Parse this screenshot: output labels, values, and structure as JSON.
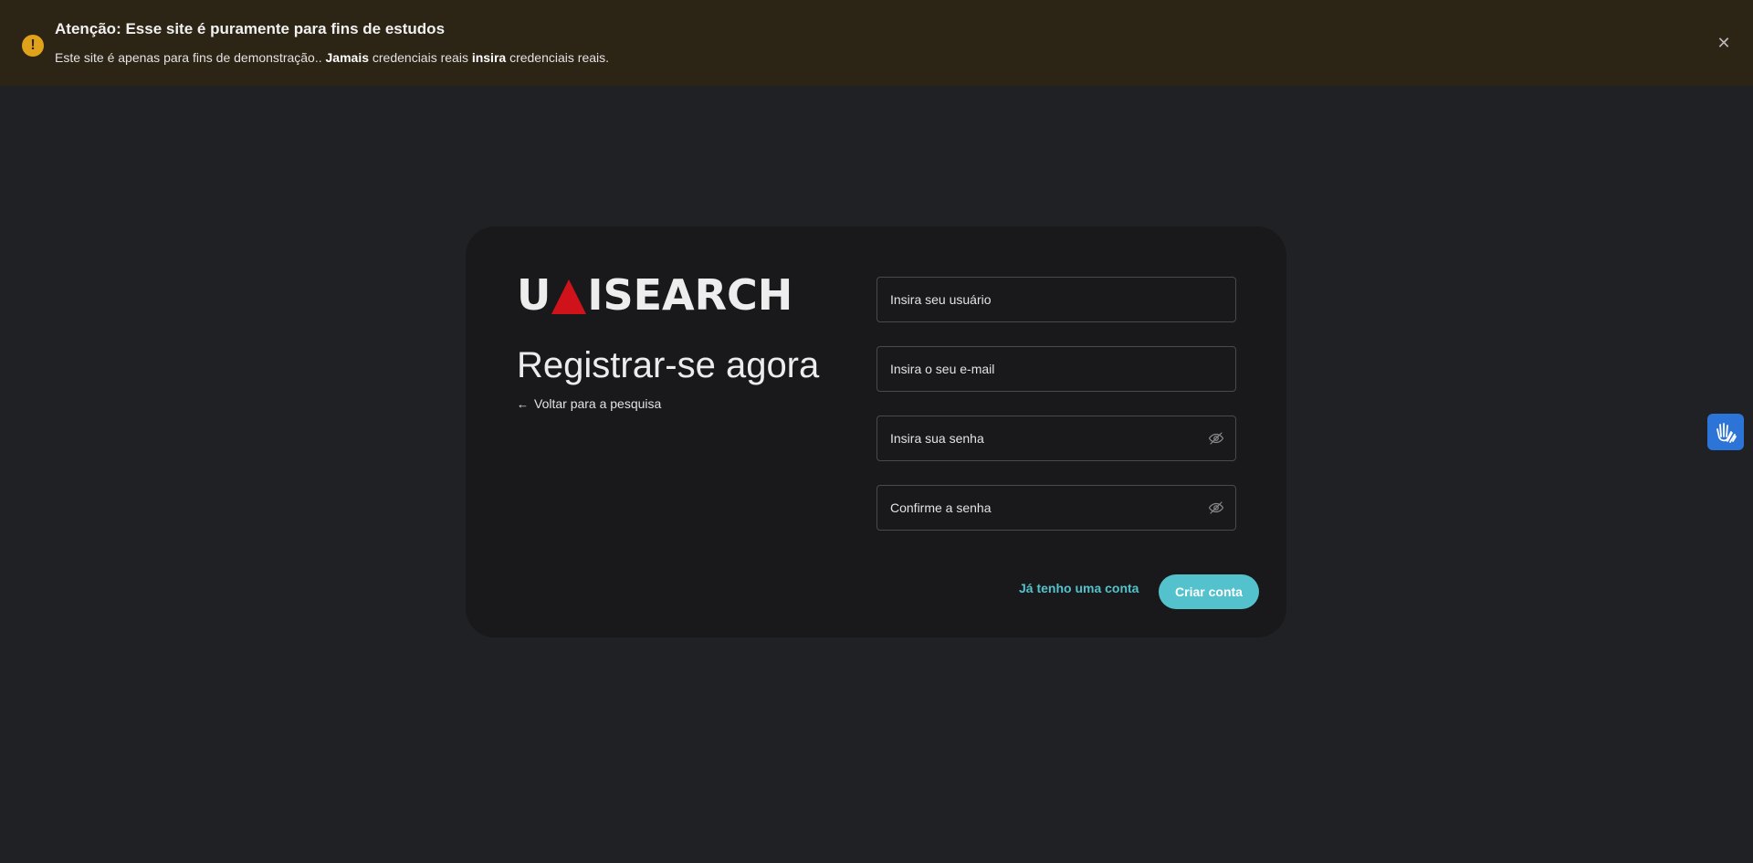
{
  "banner": {
    "icon": "exclamation-icon",
    "title": "Atenção: Esse site é puramente para fins de estudos",
    "msg_part1": "Este site é apenas para fins de demonstração.. ",
    "msg_bold1": "Jamais",
    "msg_part2": " credenciais reais ",
    "msg_bold2": "insira",
    "msg_part3": " credenciais reais.",
    "close_icon": "close-icon",
    "accent_color": "#e0a21b"
  },
  "logo": {
    "text_left": "U",
    "text_right": "ISEARCH",
    "mark_color": "#d0121b"
  },
  "page": {
    "heading": "Registrar-se agora",
    "back_arrow": "←",
    "back_label": "Voltar para a pesquisa"
  },
  "form": {
    "username_placeholder": "Insira seu usuário",
    "email_placeholder": "Insira o seu e-mail",
    "password_placeholder": "Insira sua senha",
    "confirm_placeholder": "Confirme a senha",
    "password_toggle_icon": "eye-off-icon"
  },
  "actions": {
    "login_label": "Já tenho uma conta",
    "create_label": "Criar conta",
    "accent_color": "#54c2cc"
  },
  "accessibility": {
    "icon": "sign-language-icon",
    "color": "#2d74d8"
  }
}
